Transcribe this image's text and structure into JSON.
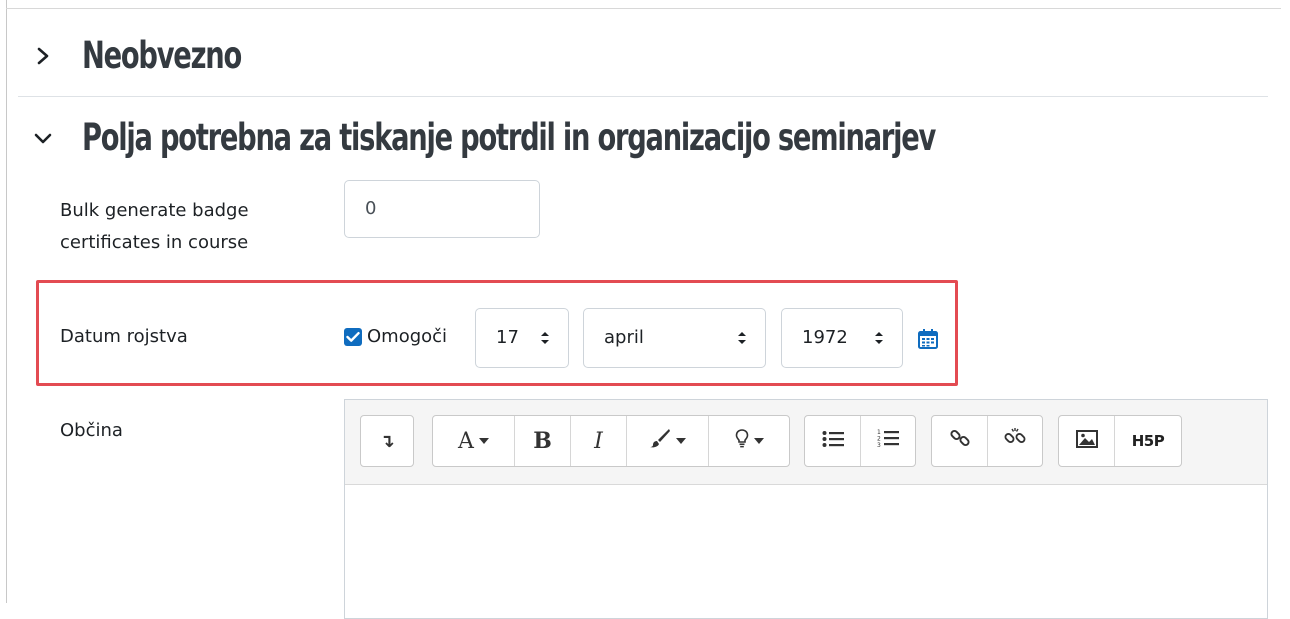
{
  "sections": {
    "optional": {
      "title": "Neobvezno",
      "expanded": false
    },
    "certificates": {
      "title": "Polja potrebna za tiskanje potrdil in organizacijo seminarjev",
      "expanded": true
    }
  },
  "fields": {
    "bulk_badge": {
      "label_line1": "Bulk generate badge",
      "label_line2": "certificates in course",
      "value": "0"
    },
    "birth_date": {
      "label": "Datum rojstva",
      "enable_label": "Omogoči",
      "enabled": true,
      "day": "17",
      "month": "april",
      "year": "1972"
    },
    "municipality": {
      "label": "Občina"
    }
  },
  "toolbar": {
    "buttons": {
      "collapse": "↴",
      "font": "A",
      "bold": "B",
      "italic": "I",
      "h5p": "H5P"
    },
    "icons": [
      "collapse-icon",
      "font-icon",
      "bold-icon",
      "italic-icon",
      "paintbrush-icon",
      "lightbulb-icon",
      "bullet-list-icon",
      "numbered-list-icon",
      "link-icon",
      "unlink-icon",
      "image-icon",
      "h5p-icon"
    ]
  },
  "colors": {
    "accent": "#0f6cbf",
    "highlight": "#e34b52",
    "heading": "#343a40"
  }
}
